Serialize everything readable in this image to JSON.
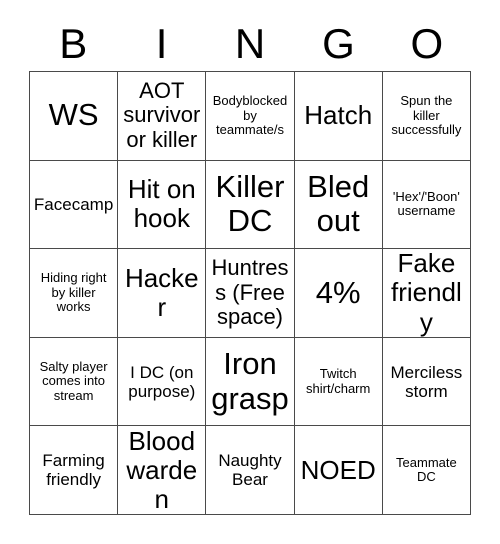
{
  "card": {
    "title_letters": [
      "B",
      "I",
      "N",
      "G",
      "O"
    ],
    "colors": {
      "border": "#4a4a4a",
      "background": "#ffffff",
      "text": "#000000"
    },
    "grid_size": "5x5",
    "rows": [
      [
        {
          "text": "WS",
          "size": "fs-xxl"
        },
        {
          "text": "AOT survivor or killer",
          "size": "fs-lg"
        },
        {
          "text": "Bodyblocked by teammate/s",
          "size": "fs-sm"
        },
        {
          "text": "Hatch",
          "size": "fs-xl"
        },
        {
          "text": "Spun the killer successfully",
          "size": "fs-sm"
        }
      ],
      [
        {
          "text": "Facecamp",
          "size": "fs-md"
        },
        {
          "text": "Hit on hook",
          "size": "fs-xl"
        },
        {
          "text": "Killer DC",
          "size": "fs-xxl"
        },
        {
          "text": "Bled out",
          "size": "fs-xxl"
        },
        {
          "text": "'Hex'/'Boon' username",
          "size": "fs-sm"
        }
      ],
      [
        {
          "text": "Hiding right by killer works",
          "size": "fs-sm"
        },
        {
          "text": "Hacker",
          "size": "fs-xl"
        },
        {
          "text": "Huntress (Free space)",
          "size": "fs-lg"
        },
        {
          "text": "4%",
          "size": "fs-xxl"
        },
        {
          "text": "Fake friendly",
          "size": "fs-xl"
        }
      ],
      [
        {
          "text": "Salty player comes into stream",
          "size": "fs-sm"
        },
        {
          "text": "I DC (on purpose)",
          "size": "fs-md"
        },
        {
          "text": "Iron grasp",
          "size": "fs-xxl"
        },
        {
          "text": "Twitch shirt/charm",
          "size": "fs-sm"
        },
        {
          "text": "Merciless storm",
          "size": "fs-md"
        }
      ],
      [
        {
          "text": "Farming friendly",
          "size": "fs-md"
        },
        {
          "text": "Blood warden",
          "size": "fs-xl"
        },
        {
          "text": "Naughty Bear",
          "size": "fs-md"
        },
        {
          "text": "NOED",
          "size": "fs-xl"
        },
        {
          "text": "Teammate DC",
          "size": "fs-sm"
        }
      ]
    ]
  }
}
